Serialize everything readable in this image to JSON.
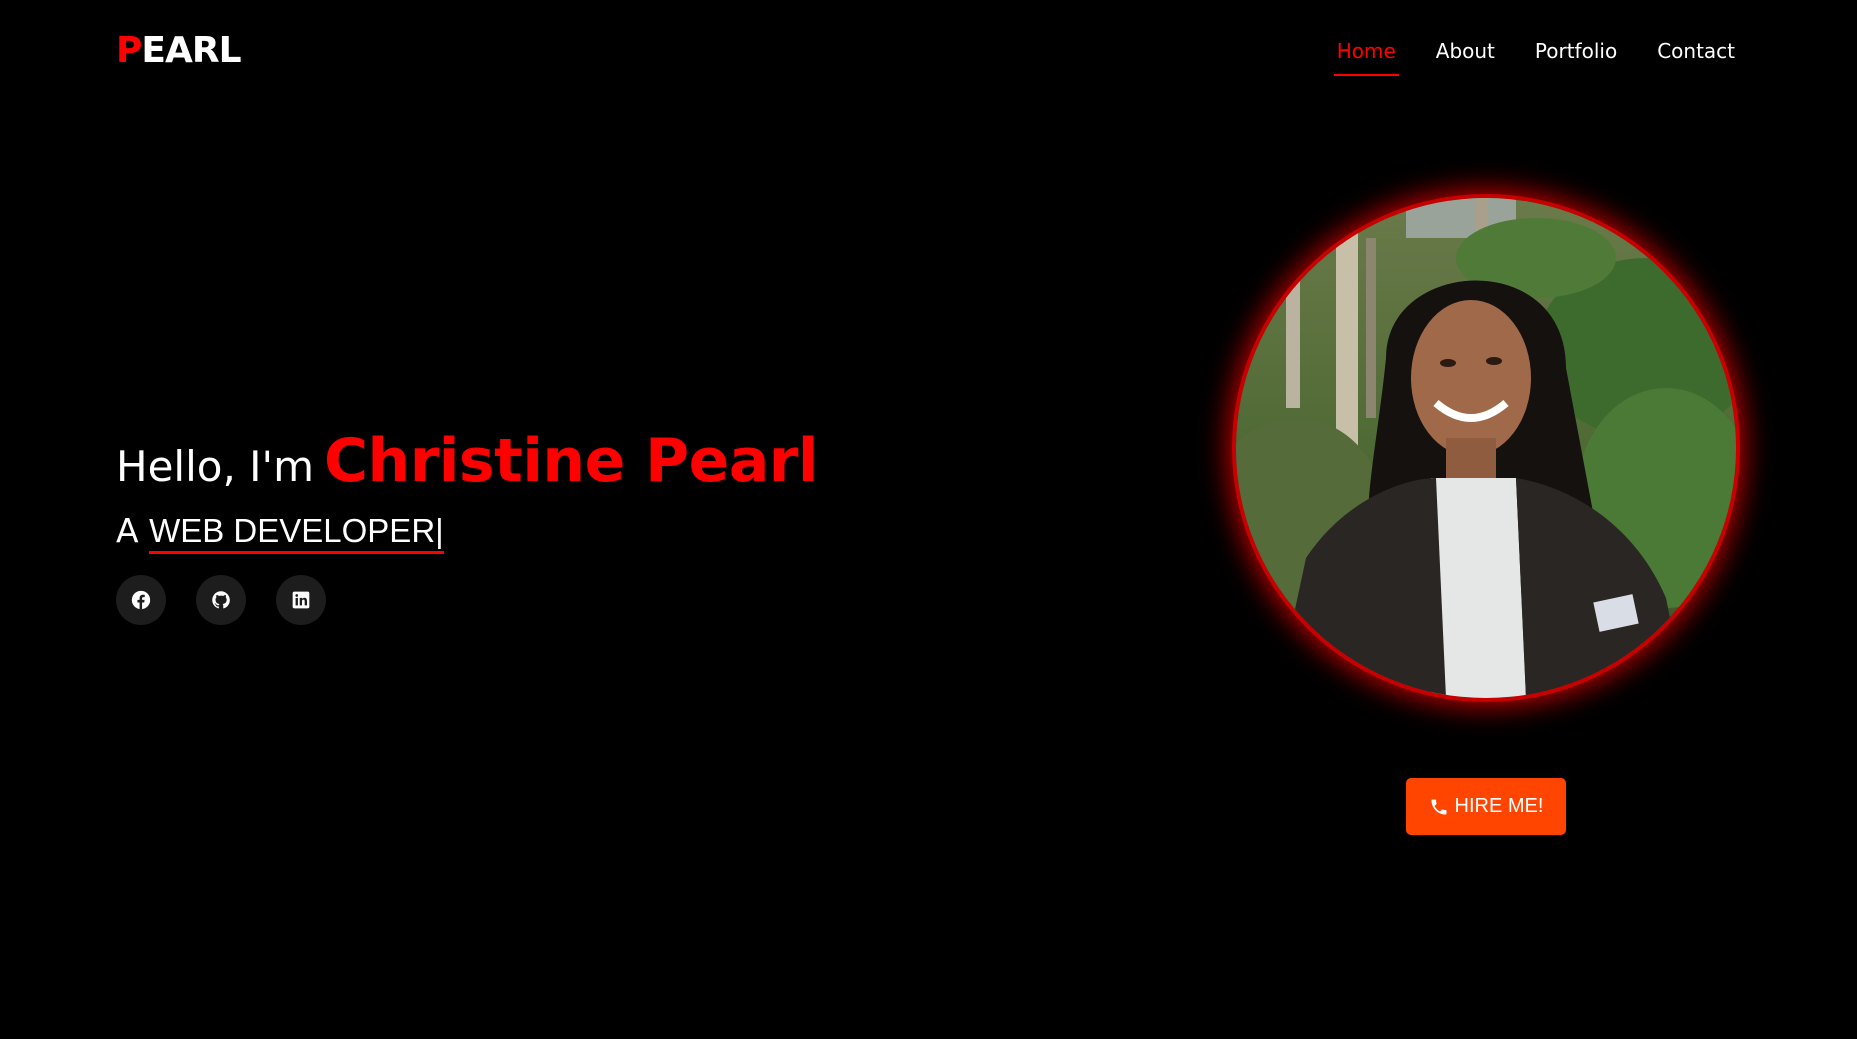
{
  "header": {
    "logo_first": "P",
    "logo_rest": "EARL",
    "nav": [
      {
        "label": "Home",
        "active": true
      },
      {
        "label": "About",
        "active": false
      },
      {
        "label": "Portfolio",
        "active": false
      },
      {
        "label": "Contact",
        "active": false
      }
    ]
  },
  "hero": {
    "hello": "Hello, I'm",
    "name": "Christine Pearl",
    "role_prefix": "A",
    "role_typed": "WEB DEVELOPER",
    "cursor": "|",
    "socials": [
      {
        "icon": "facebook-icon"
      },
      {
        "icon": "github-icon"
      },
      {
        "icon": "linkedin-icon"
      }
    ],
    "hire_label": "HIRE ME!",
    "hire_icon": "phone-icon"
  },
  "colors": {
    "accent": "#ff0000",
    "button": "#ff4500",
    "background": "#000000"
  }
}
